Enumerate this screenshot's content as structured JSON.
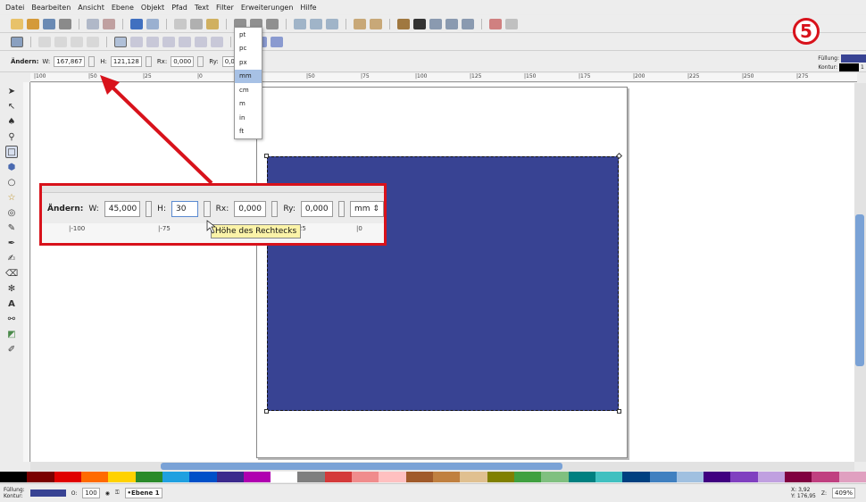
{
  "menu": [
    "Datei",
    "Bearbeiten",
    "Ansicht",
    "Ebene",
    "Objekt",
    "Pfad",
    "Text",
    "Filter",
    "Erweiterungen",
    "Hilfe"
  ],
  "controls": {
    "label": "Ändern:",
    "w_label": "W:",
    "w_value": "167,867",
    "h_label": "H:",
    "h_value": "121,128",
    "rx_label": "Rx:",
    "rx_value": "0,000",
    "ry_label": "Ry:",
    "ry_value": "0,000"
  },
  "unit_menu": [
    "pt",
    "pc",
    "px",
    "mm",
    "cm",
    "m",
    "in",
    "ft"
  ],
  "unit_selected_index": 3,
  "step_number": "5",
  "fill_stroke": {
    "fill_label": "Füllung:",
    "stroke_label": "Kontur:",
    "stroke_width": "1",
    "fill_color": "#384393",
    "stroke_color": "#000000"
  },
  "ruler_ticks": [
    "|100",
    "|50",
    "|25",
    "|0",
    "|25",
    "|50",
    "|75",
    "|100",
    "|125",
    "|150",
    "|175",
    "|200",
    "|225",
    "|250",
    "|275"
  ],
  "zoom": {
    "label": "Ändern:",
    "w_label": "W:",
    "w_value": "45,000",
    "h_label": "H:",
    "h_value": "30",
    "rx_label": "Rx:",
    "rx_value": "0,000",
    "ry_label": "Ry:",
    "ry_value": "0,000",
    "unit": "mm",
    "ruler": [
      "|-100",
      "|-75",
      "|-25",
      "|0"
    ],
    "tooltip": "Höhe des Rechtecks"
  },
  "status": {
    "fill_label": "Füllung:",
    "stroke_label": "Kontur:",
    "opacity": "O:",
    "opacity_value": "100",
    "layer": "•Ebene 1",
    "x": "X:",
    "x_value": "3,92",
    "y": "Y:",
    "y_value": "176,95",
    "z": "Z:",
    "zoom_value": "409%"
  },
  "object_color": "#384393",
  "accent_red": "#d8121b",
  "palette": [
    "#000000",
    "#7a0000",
    "#e00000",
    "#ff6a00",
    "#ffd200",
    "#2a8a2a",
    "#1fa0e0",
    "#0050c8",
    "#3c2a8c",
    "#b000b0",
    "#ffffff",
    "#7f7f7f",
    "#d43a3a",
    "#f08c8c",
    "#ffc0c0",
    "#a05a2a",
    "#c08040",
    "#e0c090",
    "#808000",
    "#40a040",
    "#80c080",
    "#008080",
    "#40c0c0",
    "#004080",
    "#4080c0",
    "#a0c0e0",
    "#400080",
    "#8040c0",
    "#c0a0e0",
    "#800040",
    "#c04080",
    "#e0a0c0"
  ]
}
